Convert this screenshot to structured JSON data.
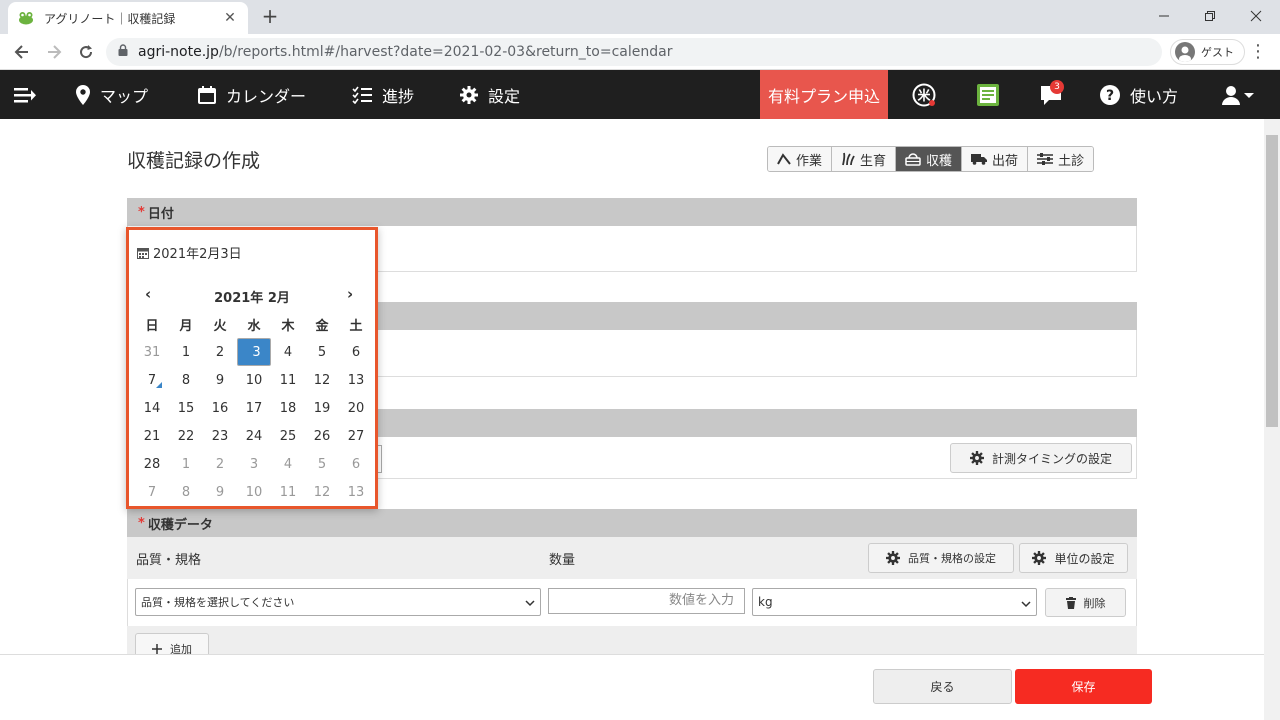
{
  "browser": {
    "tab_title": "アグリノート｜収穫記録",
    "url_main": "agri-note.jp",
    "url_rest": "/b/reports.html#/harvest?date=2021-02-03&return_to=calendar",
    "profile_label": "ゲスト"
  },
  "nav": {
    "map": "マップ",
    "calendar": "カレンダー",
    "progress": "進捗",
    "settings": "設定",
    "paid_plan": "有料プラン申込",
    "notification_count": "3",
    "help": "使い方"
  },
  "page": {
    "title": "収穫記録の作成",
    "tabs": [
      "作業",
      "生育",
      "収穫",
      "出荷",
      "土診"
    ],
    "active_tab": "収穫"
  },
  "date_section": {
    "label": "日付",
    "required_mark": "*"
  },
  "timing_button": "計測タイミングの設定",
  "harvest_section": {
    "label": "収穫データ",
    "required_mark": "*",
    "col_quality": "品質・規格",
    "col_quantity": "数量",
    "quality_settings_button": "品質・規格の設定",
    "unit_settings_button": "単位の設定",
    "quality_placeholder": "品質・規格を選択してください",
    "quantity_placeholder": "数値を入力",
    "unit_value": "kg",
    "delete_button": "削除",
    "add_button": "追加"
  },
  "footer": {
    "back": "戻る",
    "save": "保存"
  },
  "picker": {
    "selected_date": "2021年2月3日",
    "month_label": "2021年 2月",
    "weekdays": [
      "日",
      "月",
      "火",
      "水",
      "木",
      "金",
      "土"
    ],
    "weeks": [
      [
        "31",
        "1",
        "2",
        "3",
        "4",
        "5",
        "6"
      ],
      [
        "7",
        "8",
        "9",
        "10",
        "11",
        "12",
        "13"
      ],
      [
        "14",
        "15",
        "16",
        "17",
        "18",
        "19",
        "20"
      ],
      [
        "21",
        "22",
        "23",
        "24",
        "25",
        "26",
        "27"
      ],
      [
        "28",
        "1",
        "2",
        "3",
        "4",
        "5",
        "6"
      ],
      [
        "7",
        "8",
        "9",
        "10",
        "11",
        "12",
        "13"
      ]
    ]
  },
  "colors": {
    "nav_bg": "#1f1f1f",
    "paid_plan_bg": "#e8564d",
    "save_bg": "#f62b22",
    "selected_day": "#3b86c8",
    "picker_border": "#e8562c"
  }
}
